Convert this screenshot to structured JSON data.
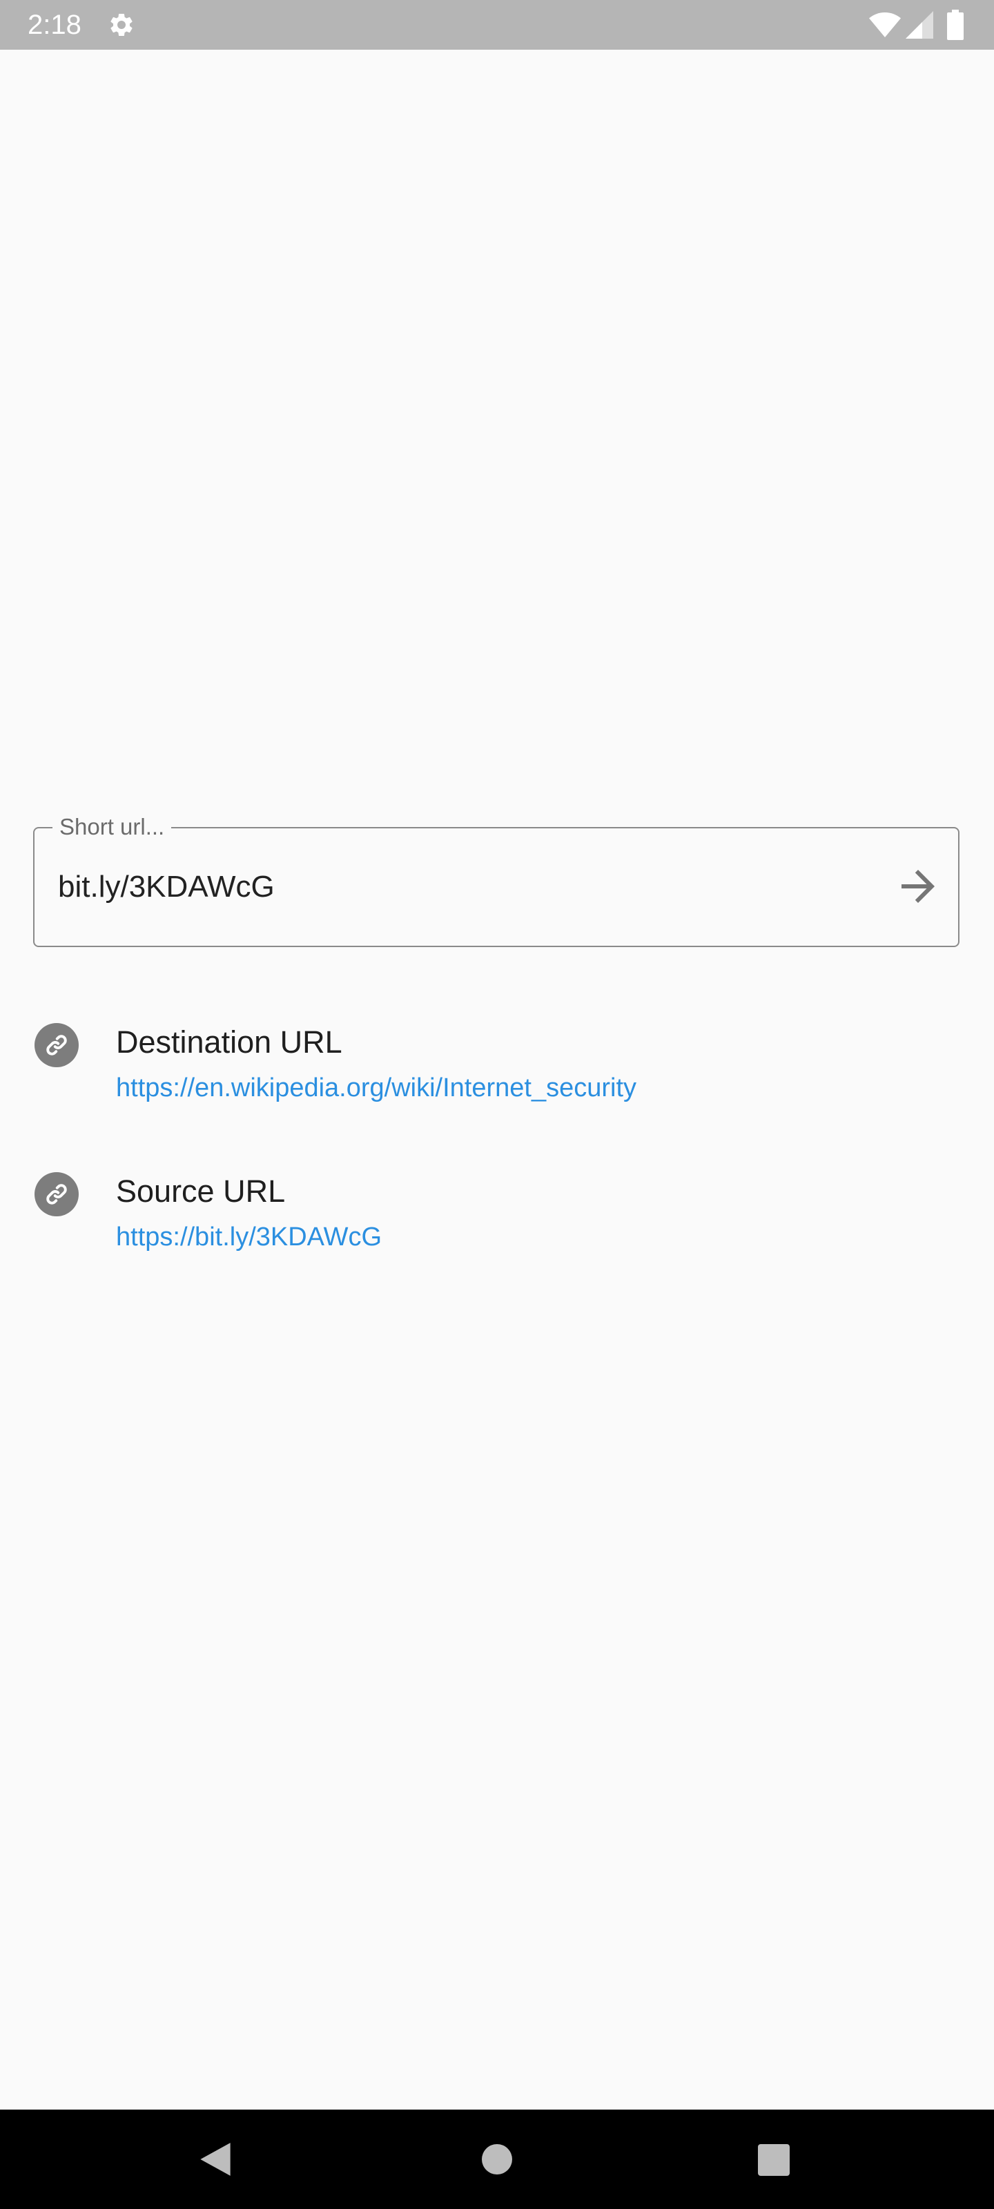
{
  "status_bar": {
    "time": "2:18",
    "icons": [
      "settings-icon",
      "wifi-icon",
      "cell-signal-icon",
      "battery-icon"
    ]
  },
  "url_field": {
    "label": "Short url...",
    "value": "bit.ly/3KDAWcG",
    "submit_icon": "arrow-forward-icon"
  },
  "results": {
    "destination": {
      "icon": "link-icon",
      "title": "Destination URL",
      "url": "https://en.wikipedia.org/wiki/Internet_security"
    },
    "source": {
      "icon": "link-icon",
      "title": "Source URL",
      "url": "https://bit.ly/3KDAWcG"
    }
  },
  "nav_bar": {
    "buttons": [
      "back-icon",
      "home-icon",
      "recents-icon"
    ]
  },
  "colors": {
    "status_bar_bg": "#b5b5b5",
    "page_bg": "#fafafa",
    "link_color": "#2b8fe0",
    "badge_bg": "#7d7d7d",
    "nav_bar_bg": "#000000"
  }
}
